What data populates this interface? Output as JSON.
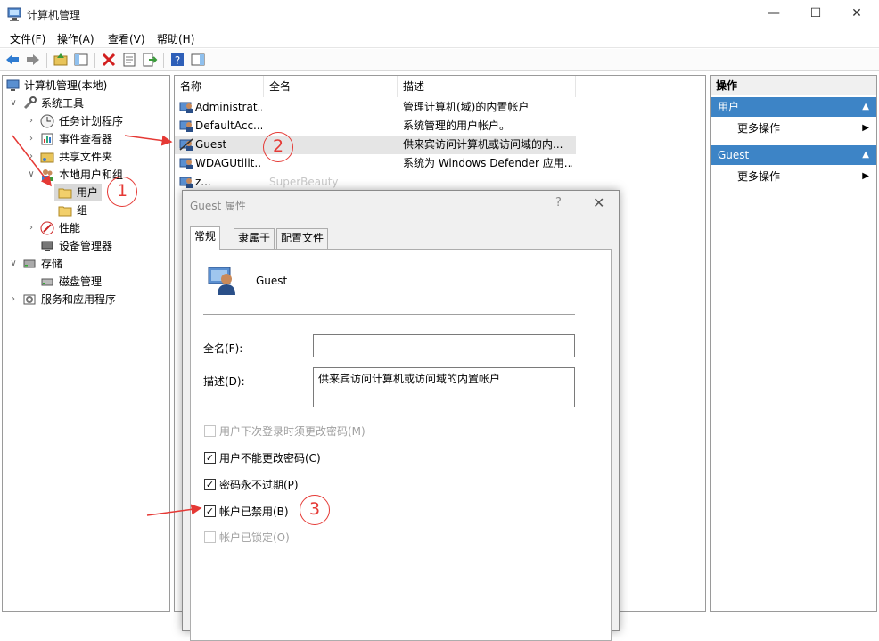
{
  "window": {
    "title": "计算机管理",
    "minimize_icon": "minimize-icon",
    "maximize_icon": "maximize-icon",
    "close_icon": "close-icon"
  },
  "menu": [
    "文件(F)",
    "操作(A)",
    "查看(V)",
    "帮助(H)"
  ],
  "toolbar": [
    "back-icon",
    "forward-icon",
    "up-folder-icon",
    "show-tree-icon",
    "delete-icon",
    "properties-icon",
    "export-icon",
    "help-icon",
    "action-pane-icon"
  ],
  "tree": {
    "root": "计算机管理(本地)",
    "system_tools": "系统工具",
    "task_scheduler": "任务计划程序",
    "event_viewer": "事件查看器",
    "shared_folders": "共享文件夹",
    "local_users_groups": "本地用户和组",
    "users": "用户",
    "groups": "组",
    "performance": "性能",
    "device_manager": "设备管理器",
    "storage": "存储",
    "disk_management": "磁盘管理",
    "services_apps": "服务和应用程序"
  },
  "list": {
    "columns": [
      "名称",
      "全名",
      "描述"
    ],
    "rows": [
      {
        "name": "Administrat...",
        "full_name": "",
        "desc": "管理计算机(域)的内置帐户"
      },
      {
        "name": "DefaultAcc...",
        "full_name": "",
        "desc": "系统管理的用户帐户。"
      },
      {
        "name": "Guest",
        "full_name": "",
        "desc": "供来宾访问计算机或访问域的内..."
      },
      {
        "name": "WDAGUtilit...",
        "full_name": "",
        "desc": "系统为 Windows Defender 应用..."
      },
      {
        "name": "z...",
        "full_name": "SuperBeauty",
        "desc": ""
      }
    ]
  },
  "actions": {
    "header": "操作",
    "sections": [
      {
        "title": "用户",
        "item": "更多操作"
      },
      {
        "title": "Guest",
        "item": "更多操作"
      }
    ]
  },
  "dialog": {
    "title": "Guest 属性",
    "help": "?",
    "close": "✕",
    "tabs": [
      "常规",
      "隶属于",
      "配置文件"
    ],
    "user_name": "Guest",
    "fullname_label": "全名(F):",
    "fullname_value": "",
    "desc_label": "描述(D):",
    "desc_value": "供来宾访问计算机或访问域的内置帐户",
    "checkboxes": [
      {
        "label": "用户下次登录时须更改密码(M)",
        "checked": false,
        "disabled": true
      },
      {
        "label": "用户不能更改密码(C)",
        "checked": true,
        "disabled": false
      },
      {
        "label": "密码永不过期(P)",
        "checked": true,
        "disabled": false
      },
      {
        "label": "帐户已禁用(B)",
        "checked": true,
        "disabled": false
      },
      {
        "label": "帐户已锁定(O)",
        "checked": false,
        "disabled": true
      }
    ]
  },
  "annotations": [
    "1",
    "2",
    "3"
  ],
  "colors": {
    "accent": "#3d84c6",
    "annotation": "#e53935",
    "selected": "#d9d9d9"
  }
}
